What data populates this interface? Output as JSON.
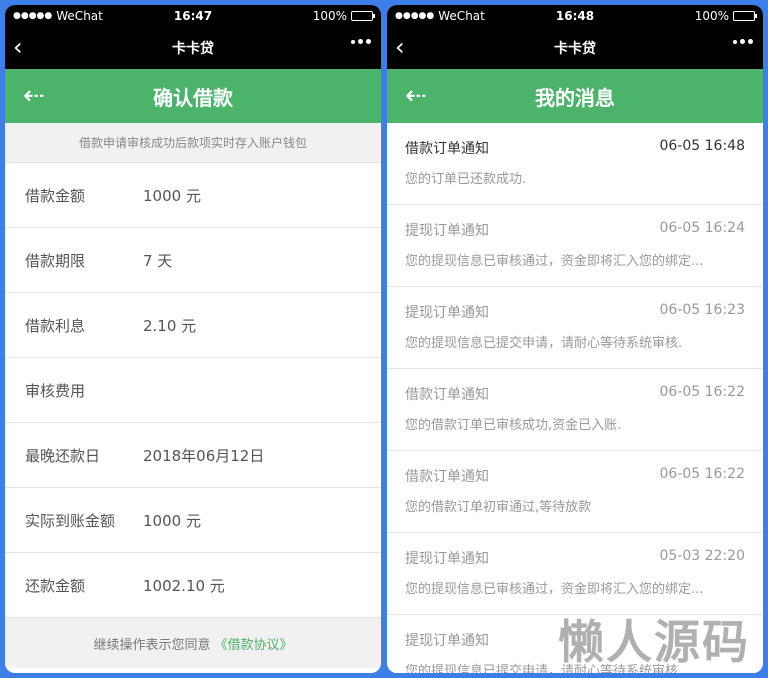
{
  "left": {
    "status": {
      "carrier": "WeChat",
      "time": "16:47",
      "battery": "100%"
    },
    "nav": {
      "title": "卡卡贷"
    },
    "header": {
      "title": "确认借款"
    },
    "notice": "借款申请审核成功后款项实时存入账户钱包",
    "rows": [
      {
        "label": "借款金额",
        "value": "1000 元"
      },
      {
        "label": "借款期限",
        "value": "7 天"
      },
      {
        "label": "借款利息",
        "value": "2.10 元"
      },
      {
        "label": "审核费用",
        "value": ""
      },
      {
        "label": "最晚还款日",
        "value": "2018年06月12日"
      },
      {
        "label": "实际到账金额",
        "value": "1000 元"
      },
      {
        "label": "还款金额",
        "value": "1002.10 元"
      }
    ],
    "agree": {
      "text": "继续操作表示您同意",
      "link": "《借款协议》"
    }
  },
  "right": {
    "status": {
      "carrier": "WeChat",
      "time": "16:48",
      "battery": "100%"
    },
    "nav": {
      "title": "卡卡贷"
    },
    "header": {
      "title": "我的消息"
    },
    "messages": [
      {
        "title": "借款订单通知",
        "time": "06-05 16:48",
        "body": "您的订单已还款成功.",
        "unread": true
      },
      {
        "title": "提现订单通知",
        "time": "06-05 16:24",
        "body": "您的提现信息已审核通过，资金即将汇入您的绑定...",
        "unread": false
      },
      {
        "title": "提现订单通知",
        "time": "06-05 16:23",
        "body": "您的提现信息已提交申请，请耐心等待系统审核.",
        "unread": false
      },
      {
        "title": "借款订单通知",
        "time": "06-05 16:22",
        "body": "您的借款订单已审核成功,资金已入账.",
        "unread": false
      },
      {
        "title": "借款订单通知",
        "time": "06-05 16:22",
        "body": "您的借款订单初审通过,等待放款",
        "unread": false
      },
      {
        "title": "提现订单通知",
        "time": "05-03 22:20",
        "body": "您的提现信息已审核通过，资金即将汇入您的绑定...",
        "unread": false
      },
      {
        "title": "提现订单通知",
        "time": "",
        "body": "您的提现信息已提交申请，请耐心等待系统审核.",
        "unread": false
      }
    ]
  },
  "watermark": "懒人源码"
}
